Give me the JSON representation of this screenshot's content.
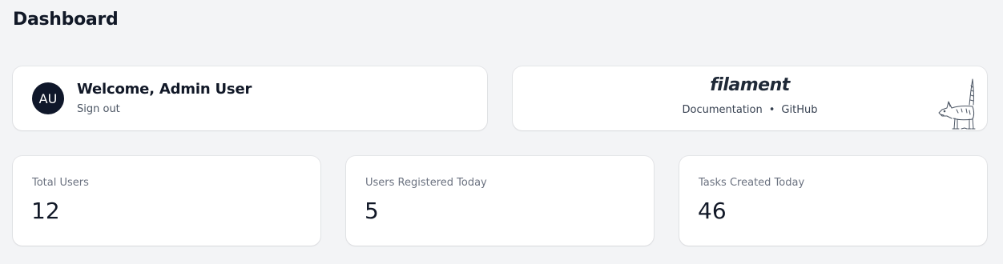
{
  "page": {
    "title": "Dashboard"
  },
  "account_widget": {
    "avatar_initials": "AU",
    "welcome": "Welcome, Admin User",
    "sign_out_label": "Sign out"
  },
  "filament_widget": {
    "logo_text": "filament",
    "links": [
      "Documentation",
      "GitHub"
    ],
    "separator": "•",
    "illustration": "dog-sketch-icon"
  },
  "stats": [
    {
      "label": "Total Users",
      "value": "12"
    },
    {
      "label": "Users Registered Today",
      "value": "5"
    },
    {
      "label": "Tasks Created Today",
      "value": "46"
    }
  ],
  "colors": {
    "background": "#f3f4f6",
    "card": "#ffffff",
    "avatar_bg": "#0f172a",
    "text_primary": "#111827",
    "text_muted": "#6b7280"
  }
}
